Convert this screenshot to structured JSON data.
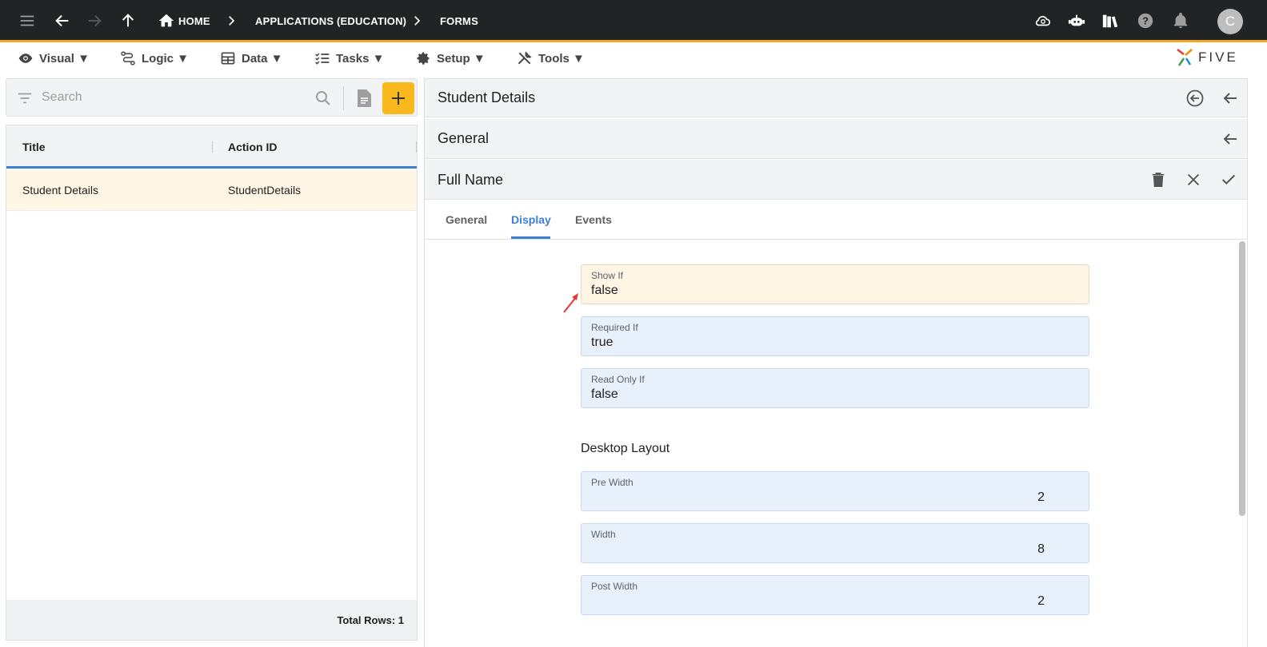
{
  "topbar": {
    "breadcrumbs": [
      "HOME",
      "APPLICATIONS (EDUCATION)",
      "FORMS"
    ],
    "avatar_letter": "C",
    "accent_color": "#f5a623"
  },
  "menu": {
    "items": [
      "Visual ▼",
      "Logic ▼",
      "Data ▼",
      "Tasks ▼",
      "Setup ▼",
      "Tools ▼"
    ],
    "logo_text": "FIVE"
  },
  "left": {
    "search_placeholder": "Search",
    "columns": [
      "Title",
      "Action ID"
    ],
    "rows": [
      {
        "title": "Student Details",
        "action_id": "StudentDetails"
      }
    ],
    "footer": "Total Rows: 1"
  },
  "right": {
    "header_title": "Student Details",
    "section_title": "General",
    "field_title": "Full Name",
    "tabs": [
      "General",
      "Display",
      "Events"
    ],
    "active_tab": "Display",
    "fields": [
      {
        "label": "Show If",
        "value": "false"
      },
      {
        "label": "Required If",
        "value": "true"
      },
      {
        "label": "Read Only If",
        "value": "false"
      }
    ],
    "desktop_layout_title": "Desktop Layout",
    "layout_fields": [
      {
        "label": "Pre Width",
        "value": "2"
      },
      {
        "label": "Width",
        "value": "8"
      },
      {
        "label": "Post Width",
        "value": "2"
      }
    ]
  }
}
